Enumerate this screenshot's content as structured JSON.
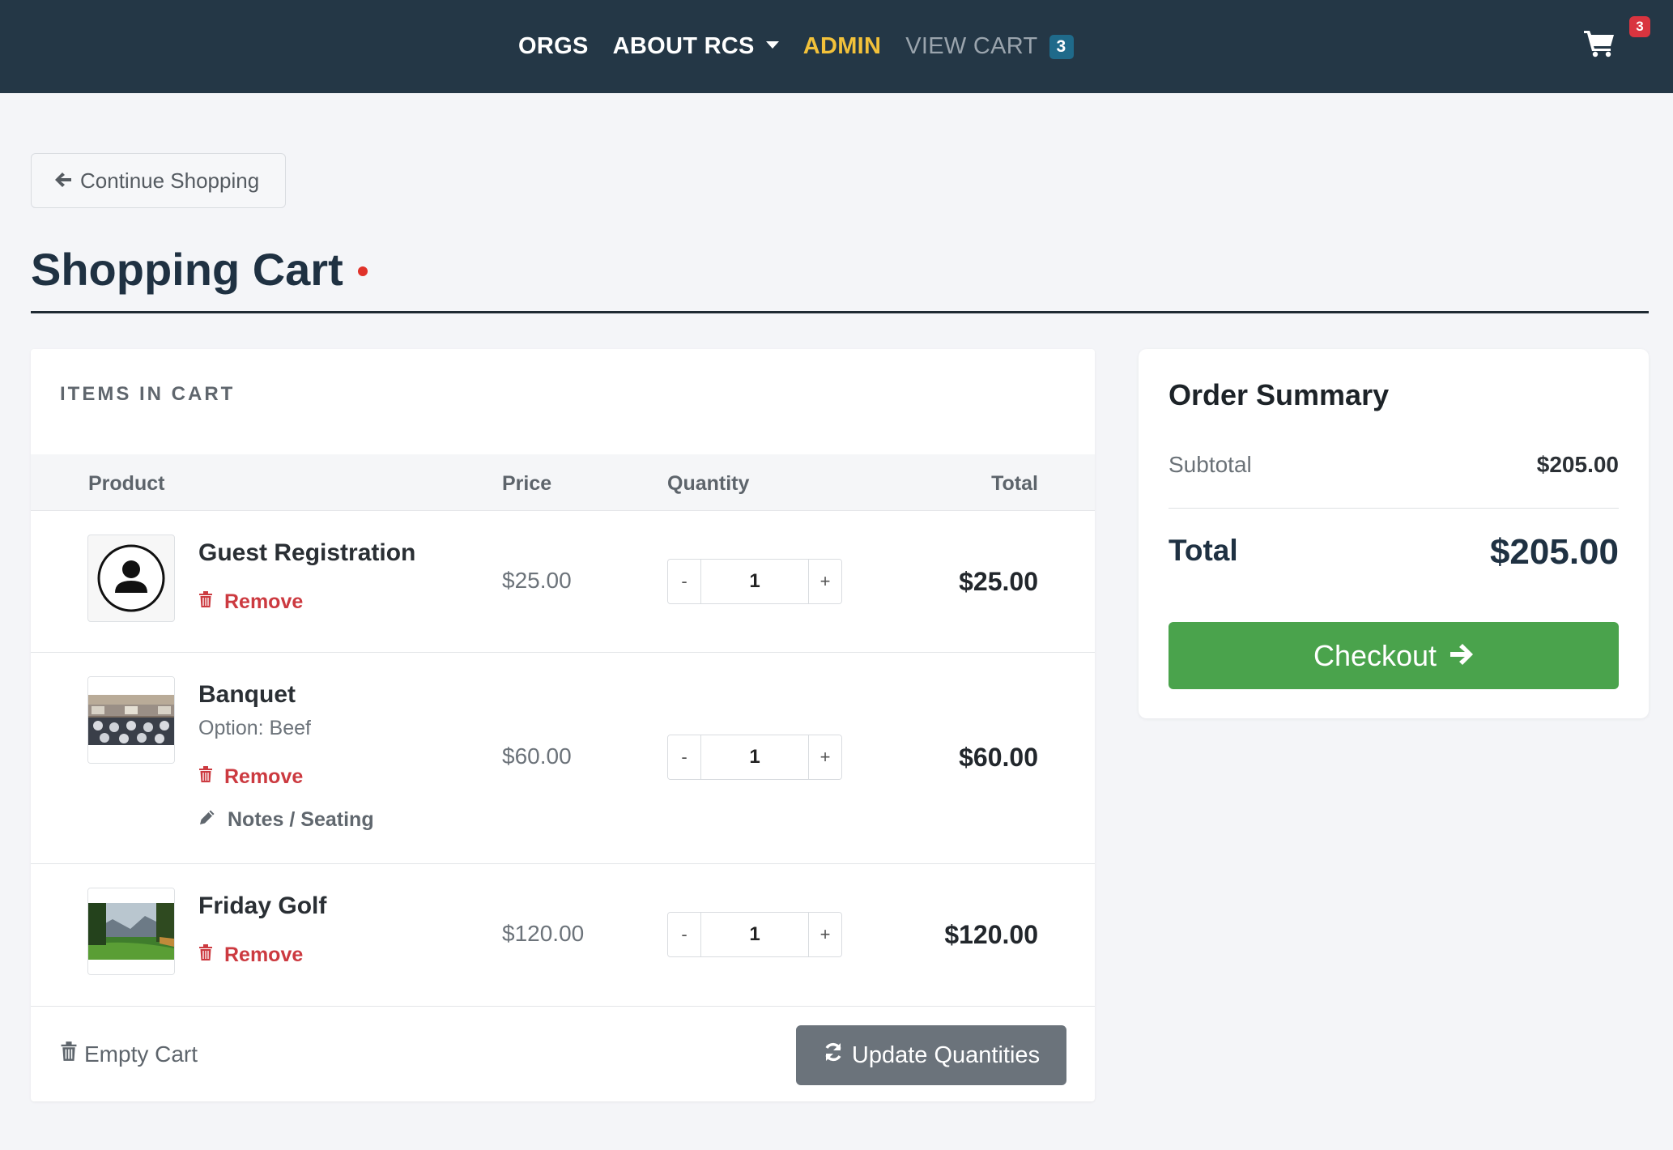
{
  "nav": {
    "orgs": "ORGS",
    "about": "ABOUT RCS",
    "admin": "ADMIN",
    "view_cart": "VIEW CART",
    "view_cart_count": "3",
    "cart_badge": "3"
  },
  "continue_label": "Continue Shopping",
  "page_title": "Shopping Cart",
  "cart": {
    "section_label": "ITEMS IN CART",
    "headers": {
      "product": "Product",
      "price": "Price",
      "quantity": "Quantity",
      "total": "Total"
    },
    "items": [
      {
        "name": "Guest Registration",
        "price": "$25.00",
        "qty": "1",
        "total": "$25.00",
        "remove": "Remove",
        "thumb": "user-avatar-icon"
      },
      {
        "name": "Banquet",
        "option": "Option: Beef",
        "price": "$60.00",
        "qty": "1",
        "total": "$60.00",
        "remove": "Remove",
        "notes": "Notes / Seating",
        "thumb": "banquet-hall-image"
      },
      {
        "name": "Friday Golf",
        "price": "$120.00",
        "qty": "1",
        "total": "$120.00",
        "remove": "Remove",
        "thumb": "golf-course-image"
      }
    ],
    "minus": "-",
    "plus": "+",
    "empty_cart": "Empty Cart",
    "update_quantities": "Update Quantities"
  },
  "summary": {
    "title": "Order Summary",
    "subtotal_label": "Subtotal",
    "subtotal_value": "$205.00",
    "total_label": "Total",
    "total_value": "$205.00",
    "checkout": "Checkout"
  },
  "colors": {
    "navbar": "#243746",
    "admin": "#f2c13a",
    "remove": "#cc3a40",
    "checkout": "#4aa34c",
    "update": "#6b737b"
  }
}
